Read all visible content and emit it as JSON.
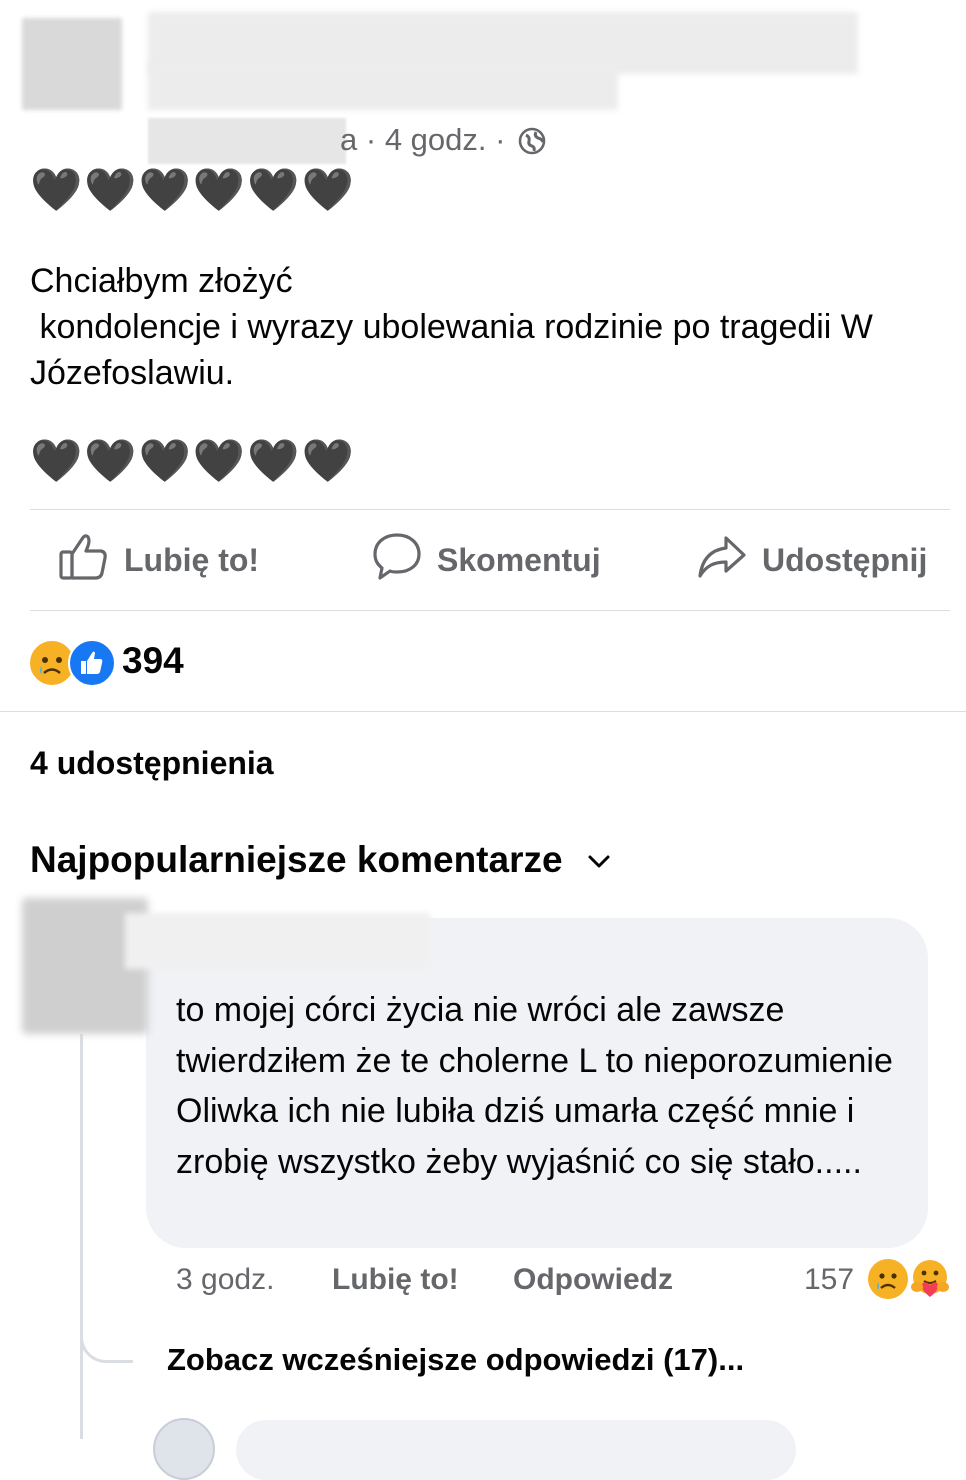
{
  "post": {
    "time": "4 godz.",
    "separator": "·",
    "author_suffix": "a",
    "audience_icon": "globe-icon",
    "hearts_top": "🖤🖤🖤🖤🖤🖤",
    "text": "Chciałbym złożyć\n kondolencje i wyrazy ubolewania rodzinie po tragedii W Józefoslawiu.",
    "hearts_bottom": "🖤🖤🖤🖤🖤🖤"
  },
  "actions": {
    "like_label": "Lubię to!",
    "like_icon": "thumbs-up-icon",
    "comment_label": "Skomentuj",
    "comment_icon": "comment-bubble-icon",
    "share_label": "Udostępnij",
    "share_icon": "share-arrow-icon"
  },
  "reactions": {
    "icons": [
      "sad-icon",
      "like-icon"
    ],
    "count": "394"
  },
  "shares": "4 udostępnienia",
  "comments_section": {
    "title": "Najpopularniejsze komentarze",
    "sort_icon": "chevron-down-icon"
  },
  "comment": {
    "text": "to mojej córci życia nie wróci ale zawsze twierdziłem że te cholerne L to nieporozumienie Oliwka ich nie lubiła dziś umarła część mnie i zrobię wszystko żeby wyjaśnić co się stało.....",
    "time": "3 godz.",
    "like_label": "Lubię to!",
    "reply_label": "Odpowiedz",
    "reaction_count": "157",
    "reaction_icons": [
      "sad-icon",
      "care-icon"
    ]
  },
  "more_replies": "Zobacz wcześniejsze odpowiedzi (17)...",
  "colors": {
    "text": "#050505",
    "secondary_text": "#65676b",
    "divider": "#dadde1",
    "bubble": "#f0f2f5",
    "like_blue": "#1877f2",
    "reaction_yellow": "#f7b125"
  }
}
